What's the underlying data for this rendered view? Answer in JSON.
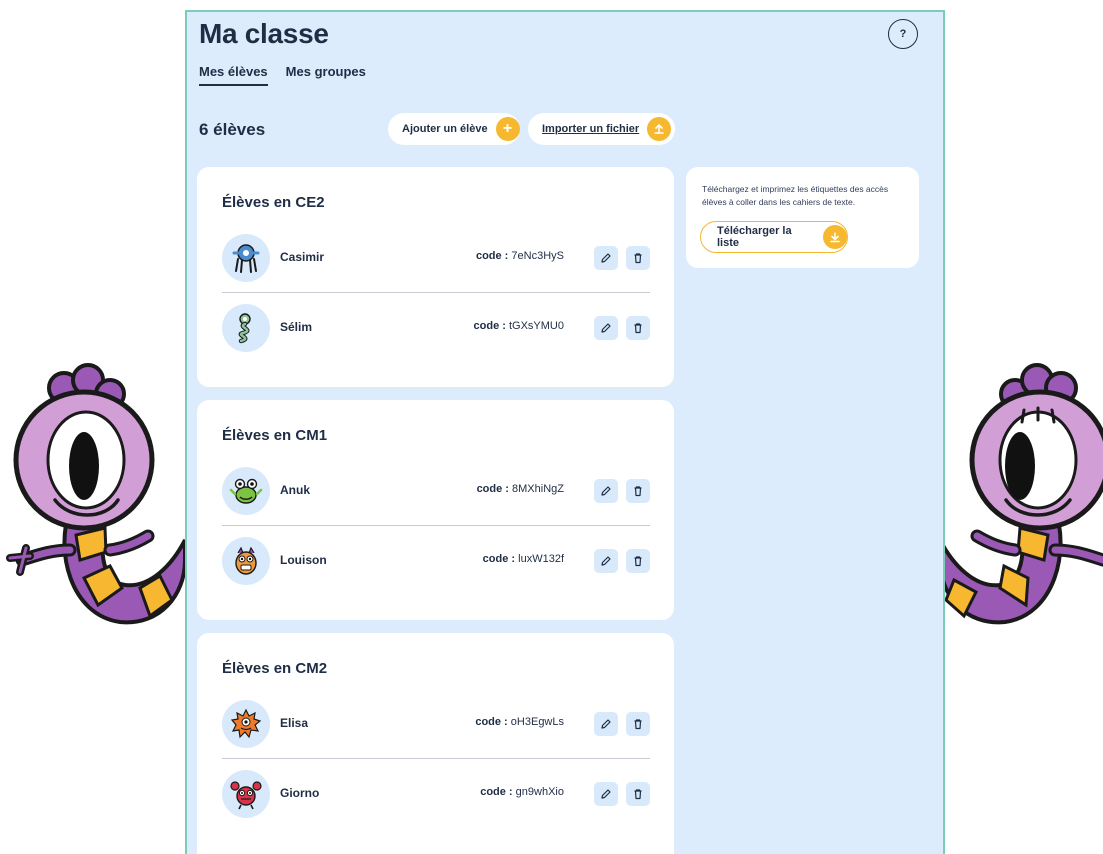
{
  "page": {
    "title": "Ma classe",
    "help_label": "?"
  },
  "tabs": [
    {
      "label": "Mes élèves",
      "active": true
    },
    {
      "label": "Mes groupes",
      "active": false
    }
  ],
  "toolbar": {
    "count": "6 élèves",
    "add_label": "Ajouter un élève",
    "import_label": "Importer un fichier"
  },
  "groups": [
    {
      "title": "Élèves en CE2",
      "students": [
        {
          "name": "Casimir",
          "code_label": "code :",
          "code": "7eNc3HyS",
          "avatar": "blue-monster-icon"
        },
        {
          "name": "Sélim",
          "code_label": "code :",
          "code": "tGXsYMU0",
          "avatar": "green-snake-monster-icon"
        }
      ]
    },
    {
      "title": "Élèves en CM1",
      "students": [
        {
          "name": "Anuk",
          "code_label": "code :",
          "code": "8MXhiNgZ",
          "avatar": "green-frog-monster-icon"
        },
        {
          "name": "Louison",
          "code_label": "code :",
          "code": "luxW132f",
          "avatar": "orange-owl-monster-icon"
        }
      ]
    },
    {
      "title": "Élèves en CM2",
      "students": [
        {
          "name": "Elisa",
          "code_label": "code :",
          "code": "oH3EgwLs",
          "avatar": "orange-spiky-monster-icon"
        },
        {
          "name": "Giorno",
          "code_label": "code :",
          "code": "gn9whXio",
          "avatar": "red-crab-monster-icon"
        }
      ]
    }
  ],
  "side_card": {
    "text": "Téléchargez et imprimez les étiquettes des accès élèves à coller dans les cahiers de texte.",
    "download_label": "Télécharger la liste"
  },
  "colors": {
    "panel_bg": "#dcecfd",
    "panel_border": "#7ccdb8",
    "accent": "#f5b82e",
    "text": "#1f2d45",
    "mascot_purple": "#9b59b6",
    "mascot_body": "#d29ed6",
    "mascot_stripe": "#f7b731"
  },
  "icons": {
    "plus": "plus-icon",
    "upload": "upload-icon",
    "download": "download-icon",
    "edit": "pencil-icon",
    "delete": "trash-icon"
  }
}
